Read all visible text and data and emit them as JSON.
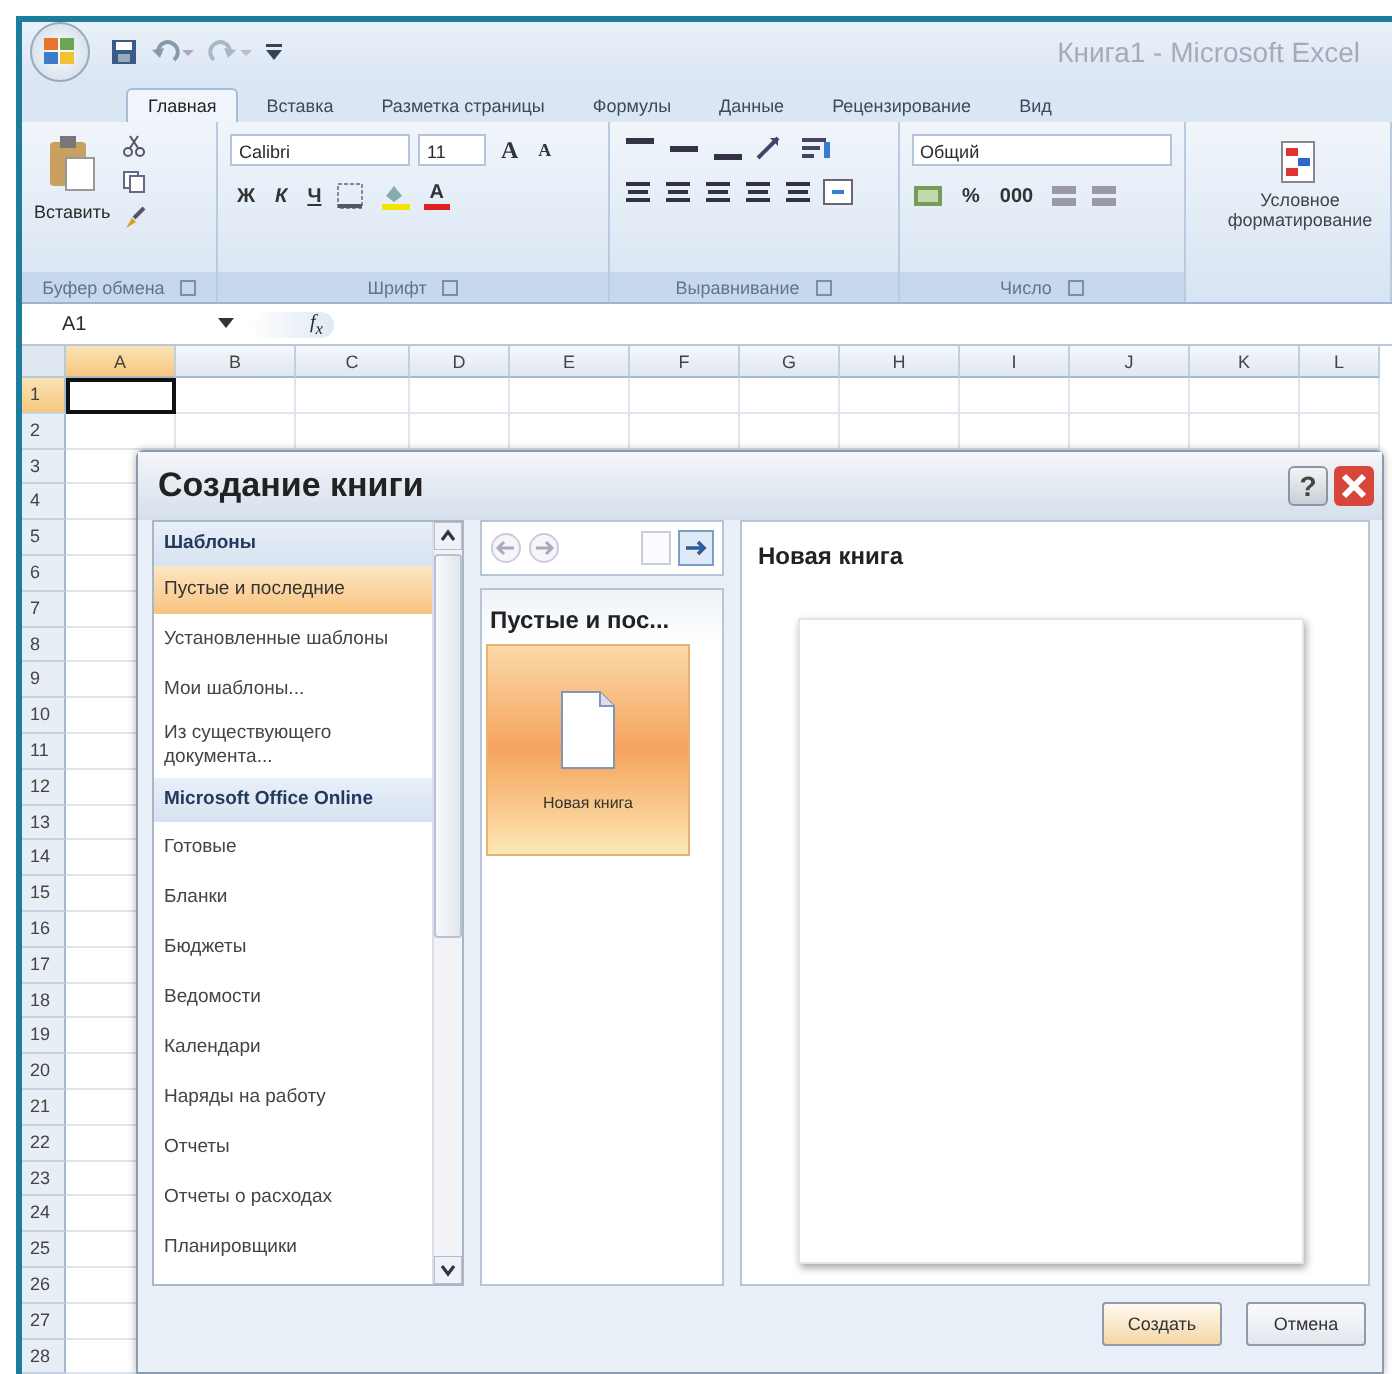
{
  "window": {
    "title": "Книга1 - Microsoft Excel"
  },
  "tabs": [
    {
      "label": "Главная",
      "selected": true
    },
    {
      "label": "Вставка",
      "selected": false
    },
    {
      "label": "Разметка страницы",
      "selected": false
    },
    {
      "label": "Формулы",
      "selected": false
    },
    {
      "label": "Данные",
      "selected": false
    },
    {
      "label": "Рецензирование",
      "selected": false
    },
    {
      "label": "Вид",
      "selected": false
    }
  ],
  "ribbon": {
    "clipboard": {
      "paste": "Вставить",
      "label": "Буфер обмена"
    },
    "font": {
      "name": "Calibri",
      "size": "11",
      "grow": "A",
      "shrink": "A",
      "bold": "Ж",
      "italic": "К",
      "underline": "Ч",
      "color_letter": "A",
      "label": "Шрифт"
    },
    "alignment": {
      "label": "Выравнивание"
    },
    "number": {
      "format": "Общий",
      "percent": "%",
      "thousands": "000",
      "label": "Число"
    },
    "styles": {
      "conditional": "Условное форматирование"
    }
  },
  "formula_bar": {
    "name_box": "A1",
    "fx": "f$_{x}$"
  },
  "sheet": {
    "columns": [
      {
        "label": "A",
        "selected": true
      },
      {
        "label": "B",
        "selected": false
      },
      {
        "label": "C",
        "selected": false
      },
      {
        "label": "D",
        "selected": false
      },
      {
        "label": "E",
        "selected": false
      },
      {
        "label": "F",
        "selected": false
      },
      {
        "label": "G",
        "selected": false
      },
      {
        "label": "H",
        "selected": false
      },
      {
        "label": "I",
        "selected": false
      },
      {
        "label": "J",
        "selected": false
      },
      {
        "label": "K",
        "selected": false
      },
      {
        "label": "L",
        "selected": false
      }
    ],
    "rows": [
      {
        "label": "1",
        "selected": true
      },
      {
        "label": "2",
        "selected": false
      },
      {
        "label": "3",
        "selected": false
      },
      {
        "label": "4",
        "selected": false
      },
      {
        "label": "5",
        "selected": false
      },
      {
        "label": "6",
        "selected": false
      },
      {
        "label": "7",
        "selected": false
      },
      {
        "label": "8",
        "selected": false
      },
      {
        "label": "9",
        "selected": false
      },
      {
        "label": "10",
        "selected": false
      },
      {
        "label": "11",
        "selected": false
      },
      {
        "label": "12",
        "selected": false
      },
      {
        "label": "13",
        "selected": false
      },
      {
        "label": "14",
        "selected": false
      },
      {
        "label": "15",
        "selected": false
      },
      {
        "label": "16",
        "selected": false
      },
      {
        "label": "17",
        "selected": false
      },
      {
        "label": "18",
        "selected": false
      },
      {
        "label": "19",
        "selected": false
      },
      {
        "label": "20",
        "selected": false
      },
      {
        "label": "21",
        "selected": false
      },
      {
        "label": "22",
        "selected": false
      },
      {
        "label": "23",
        "selected": false
      },
      {
        "label": "24",
        "selected": false
      },
      {
        "label": "25",
        "selected": false
      },
      {
        "label": "26",
        "selected": false
      },
      {
        "label": "27",
        "selected": false
      },
      {
        "label": "28",
        "selected": false
      }
    ]
  },
  "dialog": {
    "title": "Создание книги",
    "help": "?",
    "templates": [
      {
        "kind": "header",
        "label": "Шаблоны",
        "selected": false
      },
      {
        "kind": "item",
        "label": "Пустые и последние",
        "selected": true
      },
      {
        "kind": "item",
        "label": "Установленные шаблоны",
        "selected": false
      },
      {
        "kind": "item",
        "label": "Мои шаблоны...",
        "selected": false
      },
      {
        "kind": "item",
        "label": "Из существующего документа...",
        "selected": false
      },
      {
        "kind": "header",
        "label": "Microsoft Office Online",
        "selected": false
      },
      {
        "kind": "item",
        "label": "Готовые",
        "selected": false
      },
      {
        "kind": "item",
        "label": "Бланки",
        "selected": false
      },
      {
        "kind": "item",
        "label": "Бюджеты",
        "selected": false
      },
      {
        "kind": "item",
        "label": "Ведомости",
        "selected": false
      },
      {
        "kind": "item",
        "label": "Календари",
        "selected": false
      },
      {
        "kind": "item",
        "label": "Наряды на работу",
        "selected": false
      },
      {
        "kind": "item",
        "label": "Отчеты",
        "selected": false
      },
      {
        "kind": "item",
        "label": "Отчеты о расходах",
        "selected": false
      },
      {
        "kind": "item",
        "label": "Планировщики",
        "selected": false
      }
    ],
    "category": "Пустые и пос...",
    "tiles": [
      {
        "label": "Новая книга",
        "selected": true
      }
    ],
    "preview_title": "Новая книга",
    "buttons": [
      {
        "label": "Создать",
        "kind": "default"
      },
      {
        "label": "Отмена",
        "kind": "normal"
      }
    ]
  }
}
